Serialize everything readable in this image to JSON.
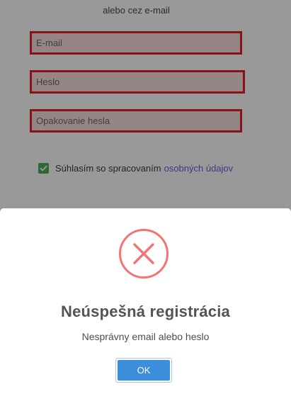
{
  "form": {
    "alt_label": "alebo cez e-mail",
    "email_placeholder": "E-mail",
    "password_placeholder": "Heslo",
    "password_repeat_placeholder": "Opakovanie hesla",
    "consent_text": "Súhlasím so spracovaním",
    "consent_link": "osobných údajov",
    "consent_checked": true
  },
  "modal": {
    "icon": "error-x-icon",
    "title": "Neúspešná registrácia",
    "message": "Nesprávny email alebo heslo",
    "ok_label": "OK"
  },
  "colors": {
    "error_border": "#e1202a",
    "checkbox": "#4caf50",
    "link": "#5b66d6",
    "ok_button": "#3c8ddc",
    "error_icon": "#f27474"
  }
}
